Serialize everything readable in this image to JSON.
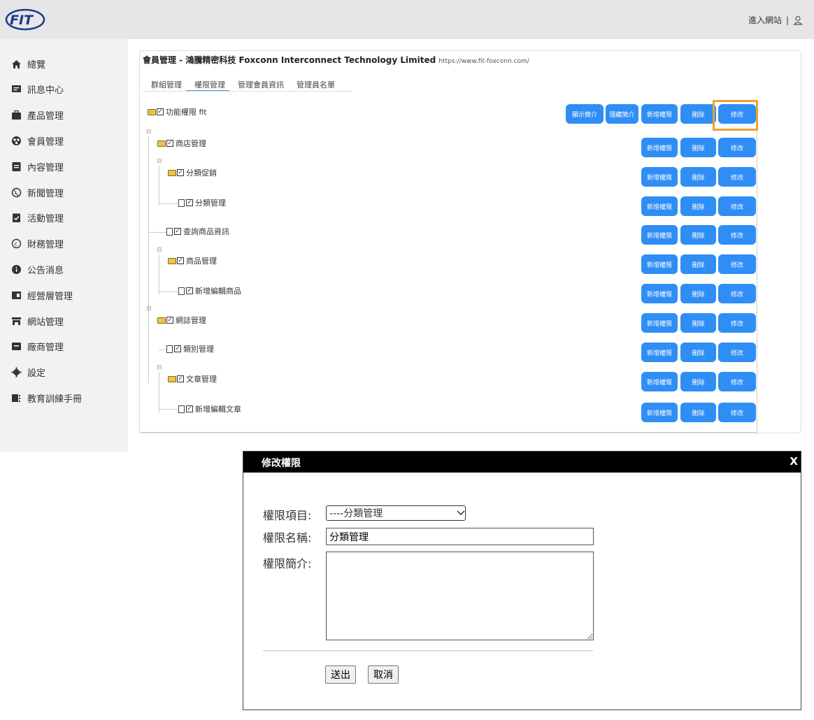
{
  "header": {
    "logo_text": "FIT",
    "enter_site": "進入網站",
    "separator": "|"
  },
  "sidebar": {
    "items": [
      {
        "label": "總覽",
        "icon": "home-icon"
      },
      {
        "label": "訊息中心",
        "icon": "message-icon"
      },
      {
        "label": "產品管理",
        "icon": "briefcase-icon"
      },
      {
        "label": "會員管理",
        "icon": "member-icon"
      },
      {
        "label": "內容管理",
        "icon": "document-icon"
      },
      {
        "label": "新聞管理",
        "icon": "globe-icon"
      },
      {
        "label": "活動管理",
        "icon": "clipboard-check-icon"
      },
      {
        "label": "財務管理",
        "icon": "copyright-icon"
      },
      {
        "label": "公告消息",
        "icon": "info-icon"
      },
      {
        "label": "經營層管理",
        "icon": "board-icon"
      },
      {
        "label": "網站管理",
        "icon": "store-icon"
      },
      {
        "label": "廠商管理",
        "icon": "archive-icon"
      },
      {
        "label": "設定",
        "icon": "gear-icon"
      },
      {
        "label": "教育訓練手冊",
        "icon": "manual-icon"
      }
    ]
  },
  "panel": {
    "title": "會員管理 - 鴻騰精密科技 Foxconn Interconnect Technology Limited",
    "url": "https://www.fit-foxconn.com/",
    "tabs": [
      "群組管理",
      "權限管理",
      "管理會員資訊",
      "管理員名單"
    ],
    "active_tab": 1
  },
  "tree": {
    "root": {
      "label": "功能權限 fit"
    },
    "nodes": [
      {
        "label": "商店管理",
        "type": "folder"
      },
      {
        "label": "分類促銷",
        "type": "folder"
      },
      {
        "label": "分類管理",
        "type": "file"
      },
      {
        "label": "查詢商品資訊",
        "type": "file"
      },
      {
        "label": "商品管理",
        "type": "folder"
      },
      {
        "label": "新增編輯商品",
        "type": "file"
      },
      {
        "label": "網誌管理",
        "type": "folder"
      },
      {
        "label": "類別管理",
        "type": "file"
      },
      {
        "label": "文章管理",
        "type": "folder"
      },
      {
        "label": "新增編輯文章",
        "type": "file"
      }
    ],
    "check_mark": "✓",
    "toggle_mark": "⊟"
  },
  "buttons": {
    "show_intro": "顯示簡介",
    "hide_intro": "隱藏簡介",
    "add": "新增權限",
    "delete": "刪除",
    "edit": "修改"
  },
  "modal": {
    "title": "修改權限",
    "close": "X",
    "item_label": "權限項目:",
    "item_value": "----分類管理",
    "name_label": "權限名稱:",
    "name_value": "分類管理",
    "desc_label": "權限簡介:",
    "desc_value": "",
    "submit": "送出",
    "cancel": "取消"
  },
  "colors": {
    "accent": "#2f8ef5",
    "highlight": "#f0a030",
    "modal_header": "#000000"
  }
}
